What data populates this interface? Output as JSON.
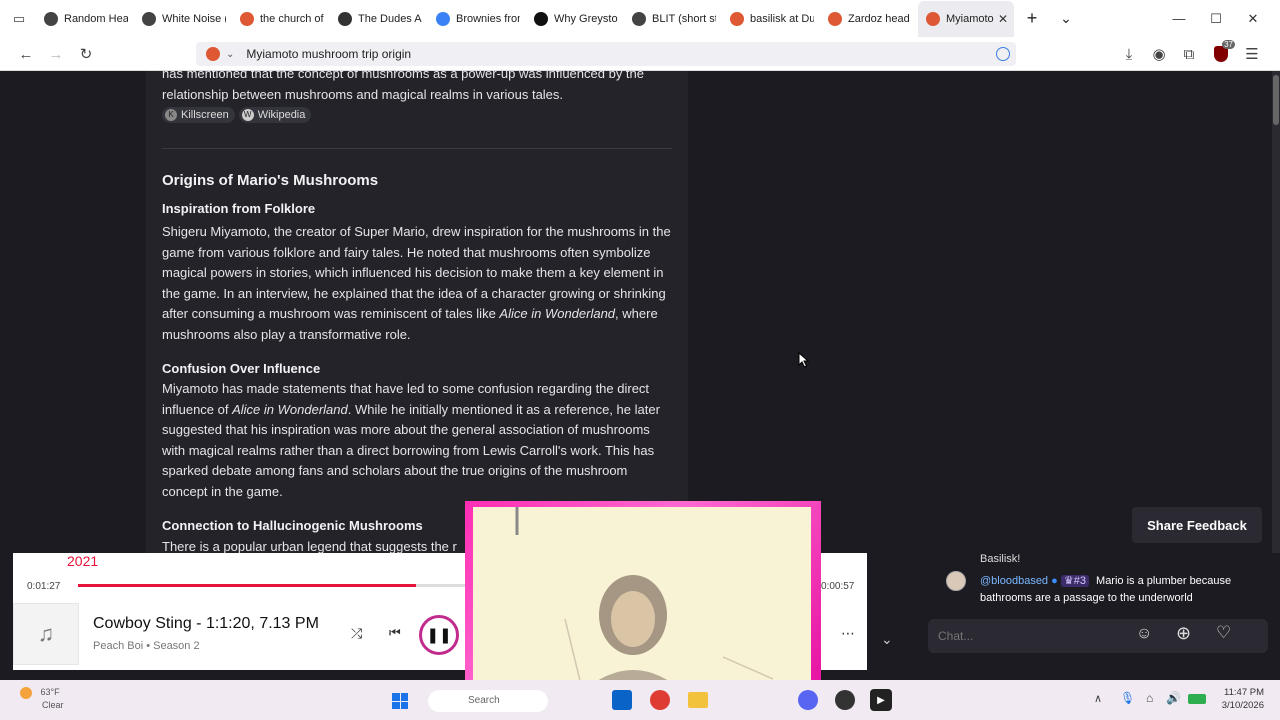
{
  "tabs": [
    {
      "label": "Random Hear",
      "icon": "wiki-icon",
      "color": "#444444"
    },
    {
      "label": "White Noise (",
      "icon": "wiki-icon",
      "color": "#444444"
    },
    {
      "label": "the church of",
      "icon": "duckduckgo-icon",
      "color": "#de5833"
    },
    {
      "label": "The Dudes Ab",
      "icon": "paw-icon",
      "color": "#333333"
    },
    {
      "label": "Brownies from",
      "icon": "search-icon",
      "color": "#3b82f6"
    },
    {
      "label": "Why Greyston",
      "icon": "app-icon",
      "color": "#111111"
    },
    {
      "label": "BLIT (short sto",
      "icon": "wiki-icon",
      "color": "#444444"
    },
    {
      "label": "basilisk at Duc",
      "icon": "duckduckgo-icon",
      "color": "#de5833"
    },
    {
      "label": "Zardoz head a",
      "icon": "duckduckgo-icon",
      "color": "#de5833"
    },
    {
      "label": "Myiamoto r",
      "icon": "duckduckgo-icon",
      "color": "#de5833",
      "active": true
    }
  ],
  "window": {
    "minimize": "—",
    "maximize": "☐",
    "close": "✕",
    "new_tab": "+",
    "tab_list": "⌄"
  },
  "nav": {
    "url": "Myiamoto mushroom trip origin"
  },
  "article": {
    "intro_line1": "has mentioned that the concept of mushrooms as a power-up was influenced by the",
    "intro_line2": "relationship between mushrooms and magical realms in various tales.",
    "sources": [
      "Killscreen",
      "Wikipedia"
    ],
    "h2": "Origins of Mario's Mushrooms",
    "s1_title": "Inspiration from Folklore",
    "s1_text_a": "Shigeru Miyamoto, the creator of Super Mario, drew inspiration for the mushrooms in the game from various folklore and fairy tales. He noted that mushrooms often symbolize magical powers in stories, which influenced his decision to make them a key element in the game. In an interview, he explained that the idea of a character growing or shrinking after consuming a mushroom was reminiscent of tales like ",
    "s1_italic": "Alice in Wonderland",
    "s1_text_b": ", where mushrooms also play a transformative role.",
    "s2_title": "Confusion Over Influence",
    "s2_text_a": "Miyamoto has made statements that have led to some confusion regarding the direct influence of ",
    "s2_italic": "Alice in Wonderland",
    "s2_text_b": ". While he initially mentioned it as a reference, he later suggested that his inspiration was more about the general association of mushrooms with magical realms rather than a direct borrowing from Lewis Carroll's work. This has sparked debate among fans and scholars about the true origins of the mushroom concept in the game.",
    "s3_title": "Connection to Hallucinogenic Mushrooms",
    "s3_text": "There is a popular urban legend that suggests the r"
  },
  "share_feedback": "Share Feedback",
  "player": {
    "year": "2021",
    "elapsed": "0:01:27",
    "duration": "0:00:57",
    "title": "Cowboy Sting - 1:1:20, 7.13 PM",
    "subtitle": "Peach Boi • Season 2",
    "progress": 0.46,
    "accent": "#e8133a"
  },
  "chat": {
    "prev_message": "Basilisk!",
    "username": "@bloodbased",
    "rank": "#3",
    "message": "Mario is a plumber because bathrooms are a passage to the underworld",
    "placeholder": "Chat..."
  },
  "taskbar": {
    "weather_temp": "63°F",
    "weather_text": "Clear",
    "search_text": "Search",
    "time": "11:47 PM",
    "date": "3/10/2026"
  },
  "extension_badge": "37"
}
